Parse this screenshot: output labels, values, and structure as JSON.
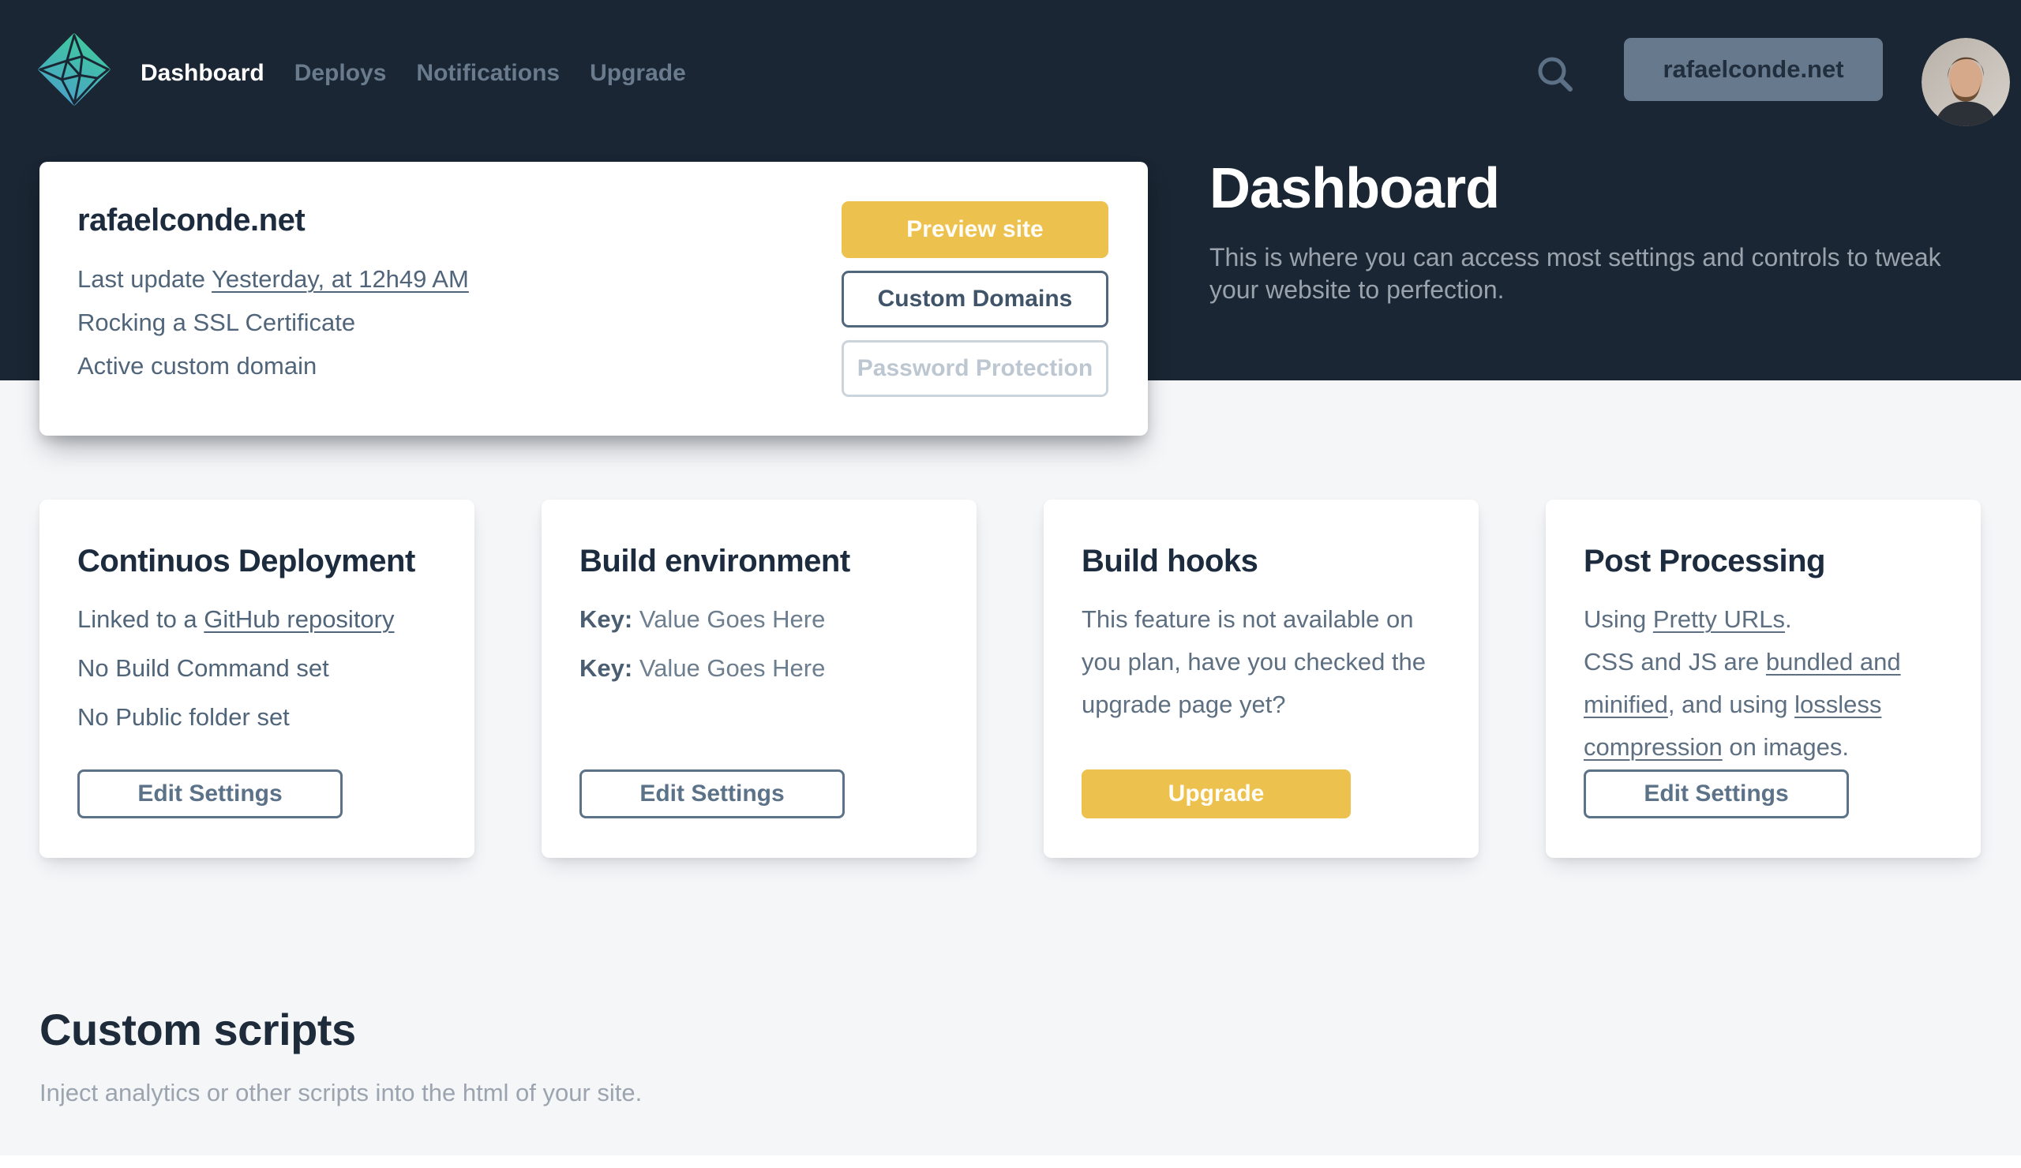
{
  "colors": {
    "navbar_bg": "#1a2633",
    "page_bg": "#f5f6f8",
    "accent_yellow": "#edc14e",
    "slate_text": "#51657a",
    "dark_heading": "#1c2c3e",
    "logo_gradient_start": "#3fcb9d",
    "logo_gradient_end": "#4aa0c9",
    "site_button_bg": "#66798d"
  },
  "nav": {
    "items": [
      {
        "label": "Dashboard",
        "active": true
      },
      {
        "label": "Deploys",
        "active": false
      },
      {
        "label": "Notifications",
        "active": false
      },
      {
        "label": "Upgrade",
        "active": false
      }
    ],
    "site_button_label": "rafaelconde.net"
  },
  "hero": {
    "title": "Dashboard",
    "subtitle": "This is where you can access most settings and controls to tweak your website to perfection."
  },
  "site_card": {
    "title": "rafaelconde.net",
    "last_update": {
      "prefix": "Last update ",
      "link": "Yesterday, at 12h49 AM"
    },
    "ssl_line": "Rocking a SSL Certificate",
    "domain_line": "Active custom domain",
    "preview_button": "Preview site",
    "custom_domains_button": "Custom Domains",
    "password_protection_button": "Password Protection"
  },
  "cards": {
    "continuous_deployment": {
      "title": "Continuos Deployment",
      "linked": {
        "prefix": "Linked to a ",
        "link": "GitHub repository"
      },
      "build_command": "No Build Command set",
      "public_folder": "No Public folder set",
      "button": "Edit Settings"
    },
    "build_environment": {
      "title": "Build environment",
      "rows": [
        {
          "key": "Key:",
          "value": " Value Goes Here"
        },
        {
          "key": "Key:",
          "value": " Value Goes Here"
        }
      ],
      "button": "Edit Settings"
    },
    "build_hooks": {
      "title": "Build hooks",
      "body": "This feature is not available on you plan, have you checked the upgrade page yet?",
      "button": "Upgrade"
    },
    "post_processing": {
      "title": "Post Processing",
      "line1": {
        "prefix": "Using ",
        "link": "Pretty URLs",
        "suffix": "."
      },
      "line2": {
        "t1": "CSS and JS are ",
        "l1": "bundled and minified",
        "t2": ", and using ",
        "l2": "lossless compression",
        "t3": " on images."
      },
      "button": "Edit Settings"
    }
  },
  "custom_scripts": {
    "title": "Custom scripts",
    "subtitle": "Inject analytics or other scripts into the html of your site."
  }
}
